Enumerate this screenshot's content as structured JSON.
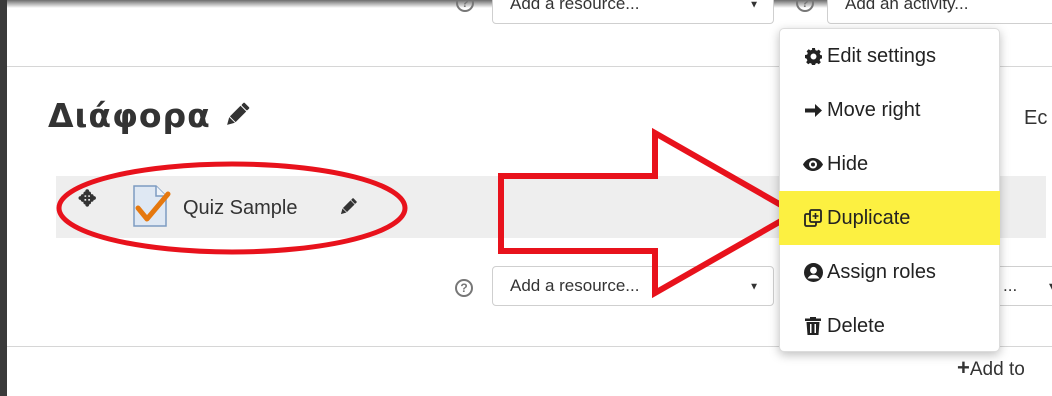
{
  "top_bar": {
    "resource_select_value": "Add a resource...",
    "activity_select_value": "Add an activity..."
  },
  "section": {
    "title": "Διάφορα",
    "edit_link": "Ec"
  },
  "activity": {
    "name": "Quiz Sample"
  },
  "bottom_bar": {
    "resource_select_value": "Add a resource...",
    "activity_select_value": "...",
    "add_topic_label": "Add to"
  },
  "menu": {
    "items": [
      {
        "label": "Edit settings",
        "icon": "gear-icon"
      },
      {
        "label": "Move right",
        "icon": "arrow-right-icon"
      },
      {
        "label": "Hide",
        "icon": "eye-icon"
      },
      {
        "label": "Duplicate",
        "icon": "duplicate-icon"
      },
      {
        "label": "Assign roles",
        "icon": "user-icon"
      },
      {
        "label": "Delete",
        "icon": "trash-icon"
      }
    ],
    "highlighted_index": 3
  },
  "colors": {
    "highlight": "#fcf041",
    "annotation_red": "#e8121c"
  }
}
